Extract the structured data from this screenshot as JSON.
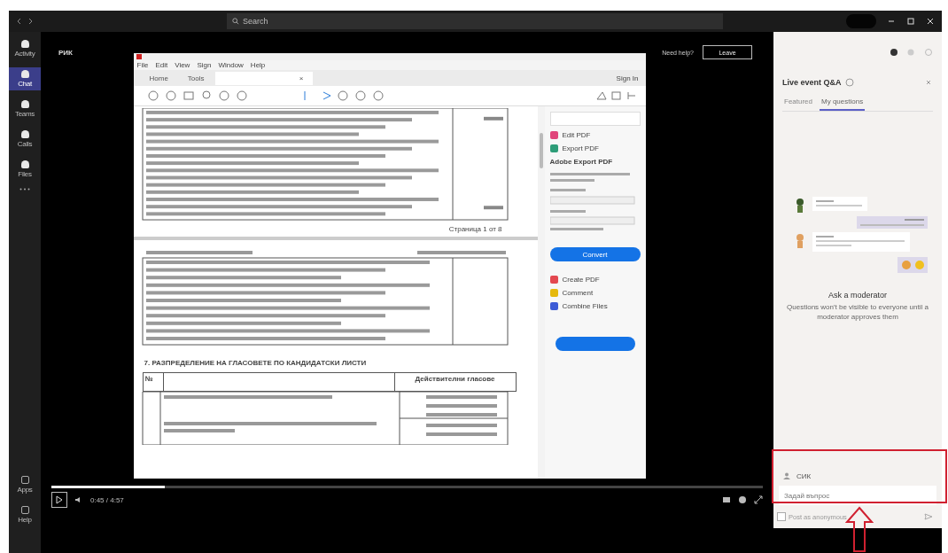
{
  "topbar": {
    "search": "Search"
  },
  "rail": [
    {
      "label": "Activity",
      "selected": false
    },
    {
      "label": "Chat",
      "selected": true
    },
    {
      "label": "Teams",
      "selected": false
    },
    {
      "label": "Calls",
      "selected": false
    },
    {
      "label": "Files",
      "selected": false
    }
  ],
  "rail_bottom": [
    {
      "label": "Apps"
    },
    {
      "label": "Help"
    }
  ],
  "event": {
    "title": "РИК",
    "help": "Need help?",
    "leave": "Leave"
  },
  "pdf": {
    "menu": [
      "File",
      "Edit",
      "View",
      "Sign",
      "Window",
      "Help"
    ],
    "tabs": [
      {
        "label": "Home",
        "selected": false
      },
      {
        "label": "Tools",
        "selected": false
      },
      {
        "close": "×",
        "selected": true
      }
    ],
    "sign_in": "Sign In",
    "footer": "Страница 1 от 8",
    "section_heading": "7. РАЗПРЕДЕЛЕНИЕ НА ГЛАСОВЕТЕ ПО КАНДИДАТСКИ ЛИСТИ",
    "table_header": [
      "№",
      "Действителни гласове"
    ],
    "tools": [
      {
        "label": "Edit PDF",
        "color": "#e0457b"
      },
      {
        "label": "Export PDF",
        "color": "#2d9d78"
      }
    ],
    "export": {
      "title": "Adobe Export PDF",
      "button": "Convert"
    },
    "tools_lower": [
      {
        "label": "Create PDF",
        "color": "#e34850"
      },
      {
        "label": "Comment",
        "color": "#e6b90d"
      },
      {
        "label": "Combine Files",
        "color": "#3c5bd6"
      }
    ]
  },
  "player": {
    "level": 0.16,
    "time": "0:45 / 4:57"
  },
  "qa": {
    "title": "Live event Q&A",
    "tabs": [
      {
        "label": "Featured",
        "selected": false
      },
      {
        "label": "My questions",
        "selected": true
      }
    ],
    "heading": "Ask a moderator",
    "text": "Questions won't be visible to everyone until a moderator approves them",
    "name": "СИК",
    "placeholder": "Задай въпрос",
    "anonymous": {
      "label": "Post as anonymous",
      "checked": false
    }
  }
}
